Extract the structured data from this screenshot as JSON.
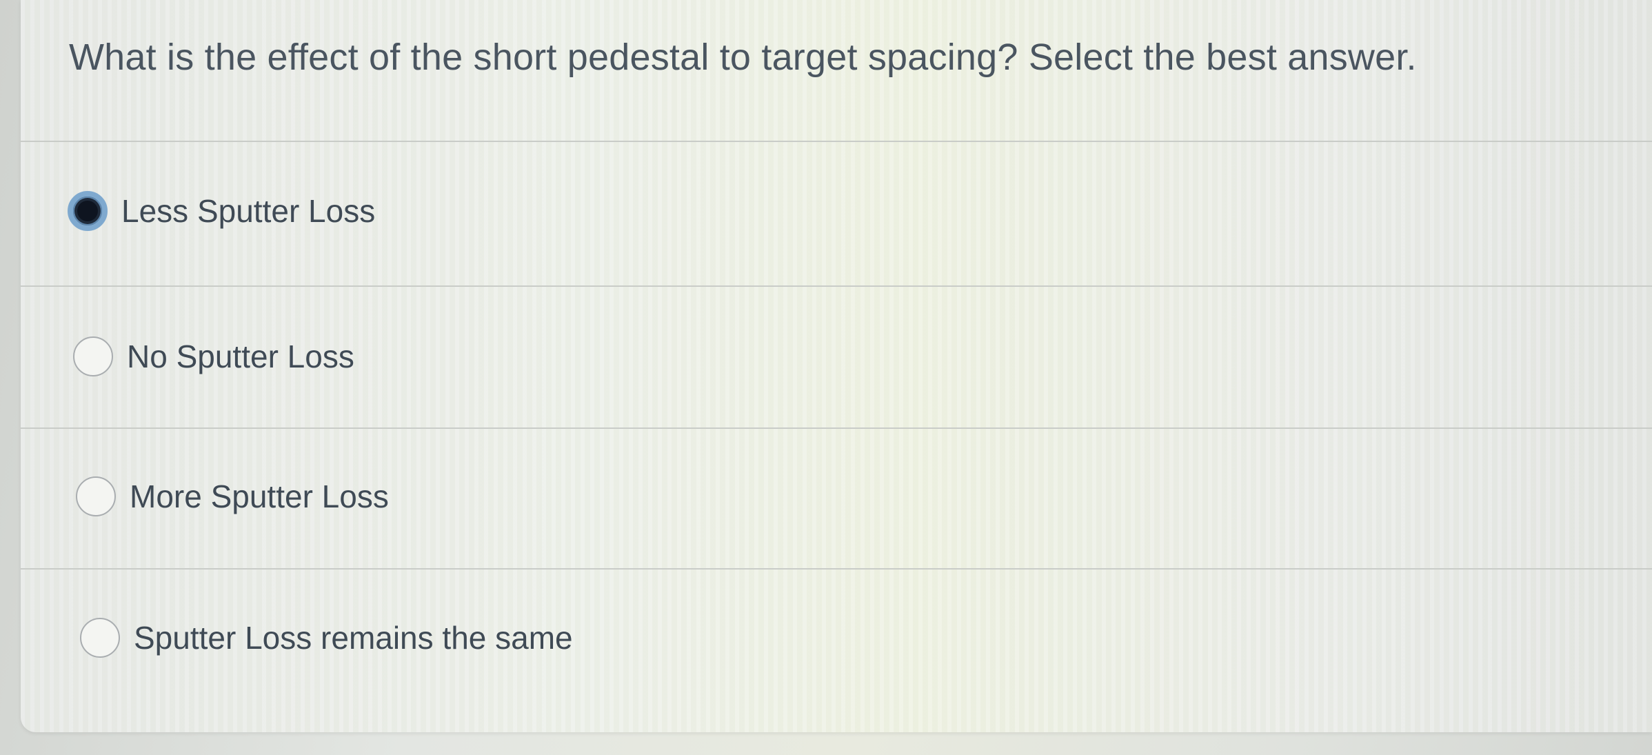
{
  "question": {
    "text": "What is the effect of the short pedestal to target spacing? Select the best answer."
  },
  "options": [
    {
      "label": "Less Sputter Loss",
      "selected": true
    },
    {
      "label": "No Sputter Loss",
      "selected": false
    },
    {
      "label": "More Sputter Loss",
      "selected": false
    },
    {
      "label": "Sputter Loss remains the same",
      "selected": false
    }
  ],
  "colors": {
    "text": "#4a5560",
    "selected_ring": "#7fa9cf",
    "selected_fill": "#1f2a3a",
    "divider": "#c9ccc8"
  }
}
